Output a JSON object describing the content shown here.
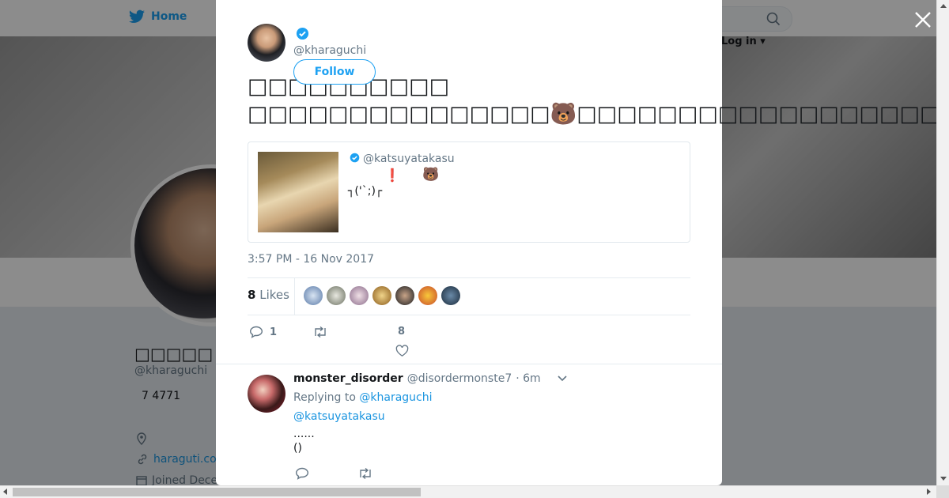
{
  "background": {
    "nav": {
      "home_label": "Home",
      "login_label": "Log in"
    },
    "profile": {
      "name": "□□□□□",
      "handle": "@kharaguchi",
      "count": "7 4771",
      "link": "haraguti.co",
      "joined": "Joined Dece"
    }
  },
  "modal": {
    "author": {
      "handle": "@kharaguchi"
    },
    "follow_label": "Follow",
    "tweet": {
      "line1": "□□□□□□□□□□",
      "line2_a": "□□□□□□□□□□□□□□□",
      "line2_b": "□□□□□□□□□□□□□□□□□□□□□□□□□□□□□□□□□□□□",
      "bear": "🐻"
    },
    "quoted": {
      "handle": "@katsuyatakasu",
      "exclaim": "❗",
      "bear": "🐻",
      "kaomoji": "┐('`;)┌"
    },
    "timestamp": "3:57 PM - 16 Nov 2017",
    "likes": {
      "count": "8",
      "label": "Likes"
    },
    "actions": {
      "reply_count": "1",
      "like_count": "8"
    },
    "reply": {
      "name": "monster_disorder",
      "handle": "@disordermonste7",
      "time": "· 6m",
      "replying_prefix": "Replying to",
      "replying_to": "@kharaguchi",
      "mention": "@katsuyatakasu",
      "line1": "......",
      "line2": "()"
    }
  },
  "colors": {
    "accent": "#1da1f2",
    "verified": "#1da1f2",
    "text": "#14171a",
    "muted": "#657786"
  },
  "icons": [
    "twitter-bird-icon",
    "search-icon",
    "close-icon",
    "verified-icon",
    "reply-icon",
    "retweet-icon",
    "heart-icon",
    "chevron-down-icon",
    "location-icon",
    "link-icon",
    "calendar-icon"
  ]
}
